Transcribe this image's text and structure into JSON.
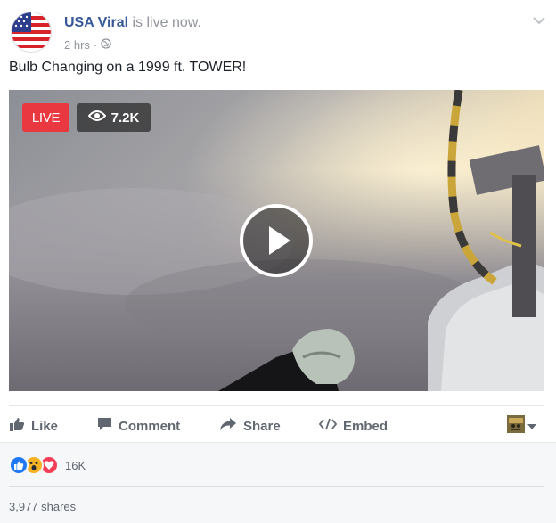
{
  "post": {
    "author_name": "USA Viral",
    "author_status": "is live now.",
    "timestamp": "2 hrs",
    "meta_separator": "·",
    "privacy_icon": "globe-icon",
    "caption": "Bulb Changing on a 1999 ft. TOWER!"
  },
  "video": {
    "live_label": "LIVE",
    "viewer_count": "7.2K",
    "viewer_icon": "eye-icon",
    "play_icon": "play-icon"
  },
  "actions": {
    "like": "Like",
    "comment": "Comment",
    "share": "Share",
    "embed": "Embed"
  },
  "reactions": {
    "types": [
      "like",
      "wow",
      "love"
    ],
    "count": "16K"
  },
  "shares": "3,977 shares",
  "colors": {
    "name": "#365899",
    "live": "#e9383f",
    "like": "#2078f4",
    "love": "#f33e58",
    "wow": "#f7b125"
  }
}
